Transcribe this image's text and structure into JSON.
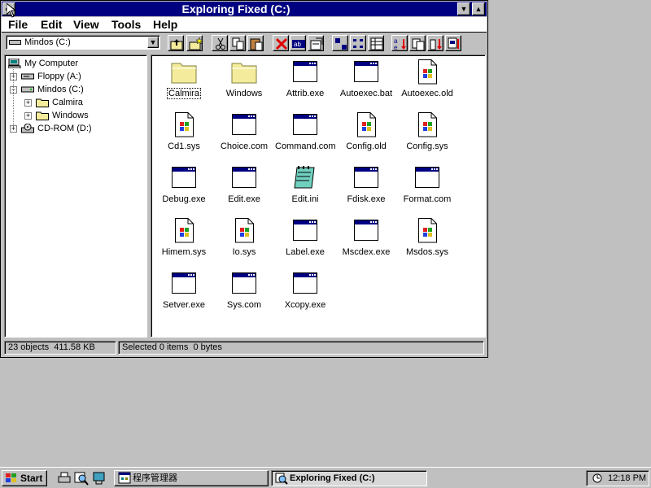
{
  "window": {
    "title": "Exploring Fixed (C:)",
    "minimize_glyph": "▼",
    "maximize_glyph": "▲"
  },
  "menubar": {
    "items": [
      {
        "label": "File"
      },
      {
        "label": "Edit"
      },
      {
        "label": "View"
      },
      {
        "label": "Tools"
      },
      {
        "label": "Help"
      }
    ]
  },
  "toolbar": {
    "drive_combo_value": "Mindos (C:)",
    "buttons": [
      {
        "name": "up-folder"
      },
      {
        "name": "new-folder"
      },
      {
        "name": "cut"
      },
      {
        "name": "copy"
      },
      {
        "name": "paste"
      },
      {
        "name": "delete"
      },
      {
        "name": "rename"
      },
      {
        "name": "properties"
      },
      {
        "name": "large-icons"
      },
      {
        "name": "small-icons"
      },
      {
        "name": "details"
      },
      {
        "name": "sort-name"
      },
      {
        "name": "sort-type"
      },
      {
        "name": "sort-size"
      },
      {
        "name": "sort-date"
      }
    ]
  },
  "tree": {
    "items": [
      {
        "label": "My Computer",
        "icon": "computer-icon",
        "level": 0,
        "expander": ""
      },
      {
        "label": "Floppy (A:)",
        "icon": "floppy-drive-icon",
        "level": 1,
        "expander": "+"
      },
      {
        "label": "Mindos (C:)",
        "icon": "hard-drive-icon",
        "level": 1,
        "expander": "−"
      },
      {
        "label": "Calmira",
        "icon": "folder-icon",
        "level": 2,
        "expander": "+"
      },
      {
        "label": "Windows",
        "icon": "folder-icon",
        "level": 2,
        "expander": "+"
      },
      {
        "label": "CD-ROM (D:)",
        "icon": "cdrom-icon",
        "level": 1,
        "expander": "+"
      }
    ]
  },
  "files": [
    {
      "name": "Calmira",
      "type": "folder",
      "selected": true
    },
    {
      "name": "Windows",
      "type": "folder"
    },
    {
      "name": "Attrib.exe",
      "type": "exe"
    },
    {
      "name": "Autoexec.bat",
      "type": "exe"
    },
    {
      "name": "Autoexec.old",
      "type": "doc"
    },
    {
      "name": "Cd1.sys",
      "type": "doc"
    },
    {
      "name": "Choice.com",
      "type": "exe"
    },
    {
      "name": "Command.com",
      "type": "exe"
    },
    {
      "name": "Config.old",
      "type": "doc"
    },
    {
      "name": "Config.sys",
      "type": "doc"
    },
    {
      "name": "Debug.exe",
      "type": "exe"
    },
    {
      "name": "Edit.exe",
      "type": "exe"
    },
    {
      "name": "Edit.ini",
      "type": "notepad"
    },
    {
      "name": "Fdisk.exe",
      "type": "exe"
    },
    {
      "name": "Format.com",
      "type": "exe"
    },
    {
      "name": "Himem.sys",
      "type": "doc"
    },
    {
      "name": "Io.sys",
      "type": "doc"
    },
    {
      "name": "Label.exe",
      "type": "exe"
    },
    {
      "name": "Mscdex.exe",
      "type": "exe"
    },
    {
      "name": "Msdos.sys",
      "type": "doc"
    },
    {
      "name": "Setver.exe",
      "type": "exe"
    },
    {
      "name": "Sys.com",
      "type": "exe"
    },
    {
      "name": "Xcopy.exe",
      "type": "exe"
    }
  ],
  "statusbar": {
    "objects": "23 objects",
    "size": "411.58 KB",
    "selected": "Selected 0 items",
    "selected_bytes": "0 bytes"
  },
  "taskbar": {
    "start_label": "Start",
    "tasks": [
      {
        "label": "程序管理器",
        "icon": "program-manager-icon",
        "active": false
      },
      {
        "label": "Exploring Fixed (C:)",
        "icon": "explorer-icon",
        "active": true
      }
    ],
    "clock": "12:18 PM"
  },
  "colors": {
    "titlebar": "#000080",
    "face": "#c0c0c0",
    "folder": "#f4ec9c"
  }
}
